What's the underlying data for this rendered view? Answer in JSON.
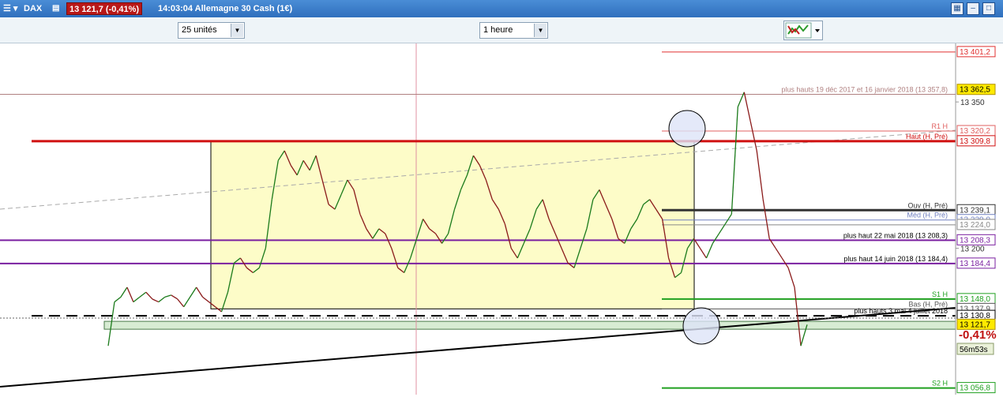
{
  "window": {
    "instrument": "DAX",
    "price_change": "13 121,7 (-0,41%)",
    "time_name": "14:03:04 Allemagne 30 Cash (1€)"
  },
  "toolbar": {
    "units_select": "25 unités",
    "period_select": "1 heure"
  },
  "chart_data": {
    "type": "candlestick",
    "timeframe": "1 heure",
    "ylim": [
      13050,
      13410
    ],
    "y_ticks": [
      13350,
      13200
    ],
    "y_tick_labels": [
      "13 350",
      "13 200"
    ],
    "close_series": [
      13100,
      13145,
      13150,
      13160,
      13145,
      13150,
      13155,
      13148,
      13145,
      13150,
      13152,
      13148,
      13140,
      13150,
      13160,
      13150,
      13145,
      13140,
      13135,
      13155,
      13185,
      13190,
      13180,
      13175,
      13180,
      13200,
      13250,
      13290,
      13300,
      13285,
      13275,
      13290,
      13280,
      13295,
      13270,
      13245,
      13240,
      13255,
      13270,
      13260,
      13235,
      13220,
      13210,
      13220,
      13215,
      13200,
      13180,
      13175,
      13190,
      13210,
      13230,
      13220,
      13215,
      13205,
      13215,
      13240,
      13260,
      13275,
      13295,
      13285,
      13270,
      13250,
      13240,
      13225,
      13200,
      13190,
      13205,
      13220,
      13240,
      13250,
      13230,
      13215,
      13200,
      13185,
      13180,
      13200,
      13220,
      13250,
      13260,
      13245,
      13230,
      13210,
      13205,
      13220,
      13230,
      13245,
      13250,
      13240,
      13230,
      13190,
      13170,
      13175,
      13200,
      13210,
      13200,
      13190,
      13205,
      13215,
      13225,
      13235,
      13345,
      13360,
      13330,
      13300,
      13250,
      13210,
      13200,
      13190,
      13180,
      13160,
      13100,
      13121.7
    ],
    "horizontal_levels": [
      {
        "value": 13401.2,
        "label": "13 401,2",
        "color": "#e03030",
        "line_label": ""
      },
      {
        "value": 13362.5,
        "label": "13 362,5",
        "color": "#d4a000",
        "line_label": ""
      },
      {
        "value": 13357.8,
        "label": "",
        "color": "#b08080",
        "line_label": "plus hauts 19 déc 2017 et 16 janvier 2018 (13 357,8)"
      },
      {
        "value": 13320.2,
        "label": "13 320,2",
        "color": "#e06060",
        "line_label": "R1 H"
      },
      {
        "value": 13309.8,
        "label": "13 309,8",
        "color": "#d01010",
        "line_label": "Haut (H, Pré)"
      },
      {
        "value": 13239.1,
        "label": "13 239,1",
        "color": "#333333",
        "line_label": "Ouv (H, Pré)"
      },
      {
        "value": 13229.0,
        "label": "13 229,0",
        "color": "#7080c0",
        "line_label": "Méd (H, Pré)"
      },
      {
        "value": 13224.0,
        "label": "13 224,0",
        "color": "#888888",
        "line_label": ""
      },
      {
        "value": 13208.3,
        "label": "13 208,3",
        "color": "#7a1fa0",
        "line_label": "plus haut 22 mai 2018 (13 208,3)"
      },
      {
        "value": 13184.4,
        "label": "13 184,4",
        "color": "#7a1fa0",
        "line_label": "plus haut 14 juin 2018 (13 184,4)"
      },
      {
        "value": 13148.0,
        "label": "13 148,0",
        "color": "#20a020",
        "line_label": "S1 H"
      },
      {
        "value": 13137.9,
        "label": "13 137,9",
        "color": "#555555",
        "line_label": "Bas (H, Pré)"
      },
      {
        "value": 13130.8,
        "label": "13 130,8",
        "color": "#000000",
        "line_label": "plus hauts 3 mai 4 juillet 2018"
      },
      {
        "value": 13121.7,
        "label": "13 121,7",
        "color": "#d4a000",
        "line_label": ""
      },
      {
        "value": 13056.8,
        "label": "13 056,8",
        "color": "#20a020",
        "line_label": "S2 H"
      }
    ],
    "current_price_label": "13 121,7",
    "change_label": "-0,41%",
    "countdown_label": "56m53s"
  }
}
